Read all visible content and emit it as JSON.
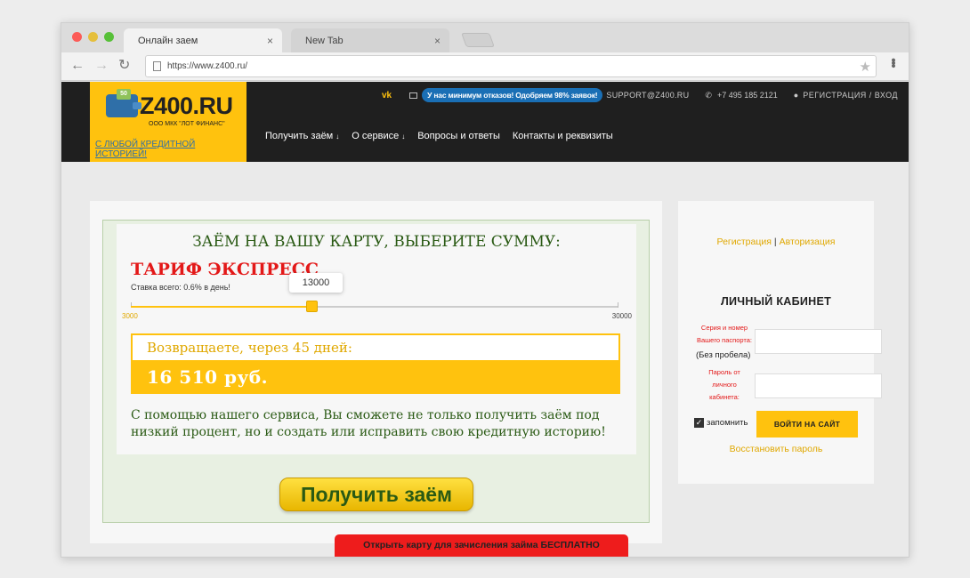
{
  "browser": {
    "tabs": [
      {
        "label": "Онлайн заем",
        "active": true
      },
      {
        "label": "New Tab",
        "active": false
      }
    ],
    "close_glyph": "×",
    "url": "https://www.z400.ru/",
    "icons": {
      "back": "arrow-left-icon",
      "forward": "arrow-right-icon",
      "reload": "reload-icon",
      "bookmark": "star-icon",
      "menu": "kebab-menu-icon"
    }
  },
  "header": {
    "logo_text": "Z400.RU",
    "logo_coin": "50",
    "logo_company": "ООО МКК \"ЛОТ ФИНАНС\"",
    "logo_tagline": "С ЛЮБОЙ КРЕДИТНОЙ ИСТОРИЕЙ!",
    "vk_label": "vk",
    "promo": "У нас минимум отказов! Одобряем 98% заявок!",
    "support_email": "SUPPORT@Z400.RU",
    "phone": "+7 495 185 2121",
    "register_login": "РЕГИСТРАЦИЯ / ВХОД",
    "nav": [
      {
        "label": "Получить заём",
        "has_dropdown": true
      },
      {
        "label": "О сервисе",
        "has_dropdown": true
      },
      {
        "label": "Вопросы и ответы",
        "has_dropdown": false
      },
      {
        "label": "Контакты и реквизиты",
        "has_dropdown": false
      }
    ]
  },
  "calculator": {
    "title": "ЗАЁМ НА ВАШУ КАРТУ, ВЫБЕРИТЕ СУММУ:",
    "tariff": "ТАРИФ ЭКСПРЕСС",
    "rate": "Ставка всего: 0.6% в день!",
    "slider_value": "13000",
    "slider_min": "3000",
    "slider_max": "30000",
    "return_label": "Возвращаете, через 45 дней:",
    "return_amount": "16 510 руб.",
    "description": "С помощью нашего сервиса, Вы сможете не только получить заём под низкий процент, но и создать или исправить свою кредитную историю!",
    "cta": "Получить заём"
  },
  "sidebar": {
    "register": "Регистрация",
    "separator": "|",
    "authorize": "Авторизация",
    "cabinet_title": "ЛИЧНЫЙ КАБИНЕТ",
    "passport_label_1": "Серия и номер",
    "passport_label_2": "Вашего паспорта:",
    "passport_note": "(Без пробела)",
    "password_label_1": "Пароль от",
    "password_label_2": "личного",
    "password_label_3": "кабинета:",
    "remember": "запомнить",
    "remember_checked": true,
    "login_button": "ВОЙТИ НА САЙТ",
    "restore": "Восстановить пароль"
  },
  "banner": {
    "open_card": "Открыть карту для зачисления займа БЕСПЛАТНО"
  },
  "colors": {
    "accent": "#ffc20e",
    "header_bg": "#1f1f1f",
    "tariff_red": "#e31818",
    "text_green": "#2a5a14",
    "promo_blue": "#1a6fb5"
  }
}
